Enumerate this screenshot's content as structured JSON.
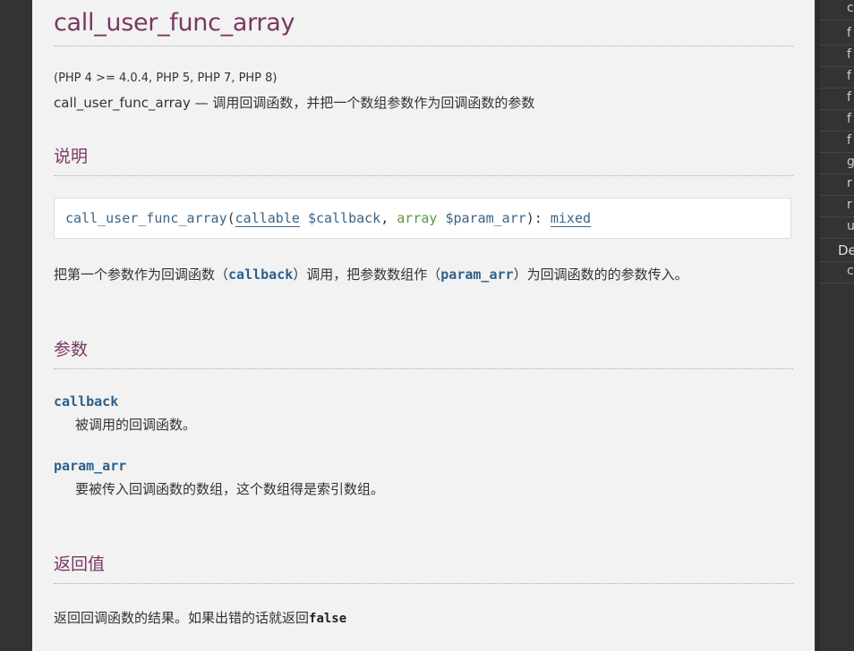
{
  "page": {
    "title": "call_user_func_array",
    "version": "(PHP 4 >= 4.0.4, PHP 5, PHP 7, PHP 8)",
    "purpose": "call_user_func_array — 调用回调函数，并把一个数组参数作为回调函数的参数"
  },
  "description": {
    "heading": "说明",
    "synopsis": {
      "func": "call_user_func_array",
      "open": "(",
      "type1": "callable",
      "var1": "$callback",
      "comma": ", ",
      "type2": "array",
      "var2": "$param_arr",
      "close": "): ",
      "return_type": "mixed"
    },
    "text_1": "把第一个参数作为回调函数（",
    "text_code1": "callback",
    "text_2": "）调用，把参数数组作（",
    "text_code2": "param_arr",
    "text_3": "）为回调函数的的参数传入。"
  },
  "parameters": {
    "heading": "参数",
    "items": [
      {
        "name": "callback",
        "desc": "被调用的回调函数。"
      },
      {
        "name": "param_arr",
        "desc": "要被传入回调函数的数组，这个数组得是索引数组。"
      }
    ]
  },
  "return_values": {
    "heading": "返回值",
    "text": "返回回调函数的结果。如果出错的话就返回",
    "code": "false"
  },
  "sidebar": {
    "items": [
      "c",
      "f",
      "f",
      "f",
      "f",
      "f",
      "f",
      "g",
      "r",
      "r",
      "u"
    ],
    "section": "De",
    "after": [
      "c"
    ]
  }
}
